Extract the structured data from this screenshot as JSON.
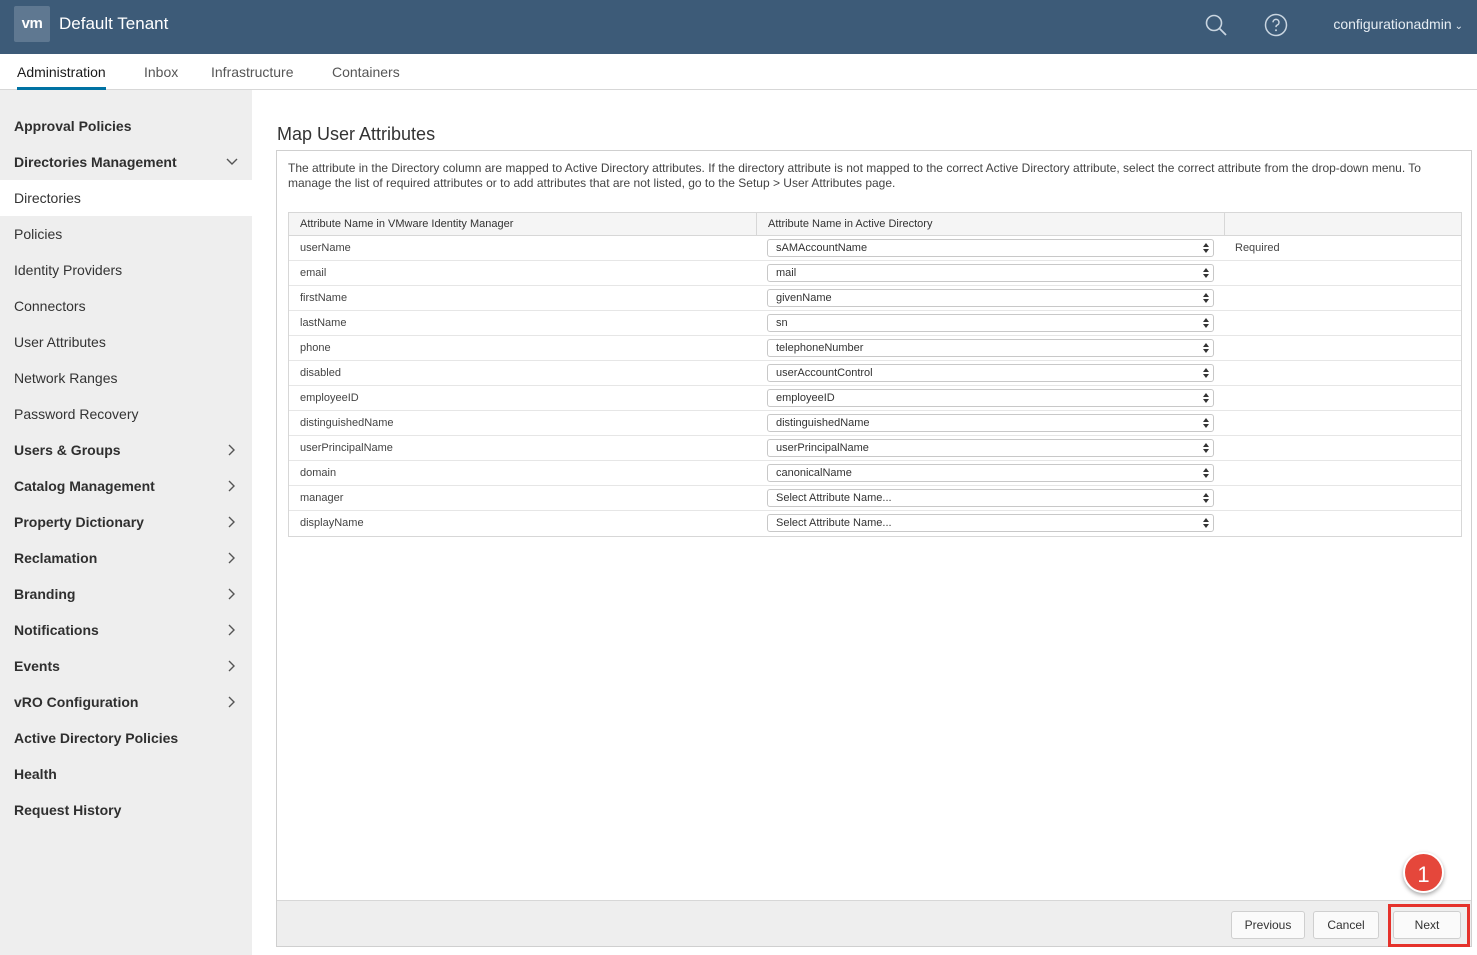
{
  "header": {
    "logo": "vm",
    "tenant": "Default Tenant",
    "user": "configurationadmin"
  },
  "tabs": [
    {
      "label": "Administration",
      "active": true
    },
    {
      "label": "Inbox"
    },
    {
      "label": "Infrastructure"
    },
    {
      "label": "Containers"
    }
  ],
  "sidebar": {
    "items": [
      {
        "label": "Approval Policies"
      },
      {
        "label": "Directories Management"
      },
      {
        "label": "Directories"
      },
      {
        "label": "Policies"
      },
      {
        "label": "Identity Providers"
      },
      {
        "label": "Connectors"
      },
      {
        "label": "User Attributes"
      },
      {
        "label": "Network Ranges"
      },
      {
        "label": "Password Recovery"
      },
      {
        "label": "Users & Groups"
      },
      {
        "label": "Catalog Management"
      },
      {
        "label": "Property Dictionary"
      },
      {
        "label": "Reclamation"
      },
      {
        "label": "Branding"
      },
      {
        "label": "Notifications"
      },
      {
        "label": "Events"
      },
      {
        "label": "vRO Configuration"
      },
      {
        "label": "Active Directory Policies"
      },
      {
        "label": "Health"
      },
      {
        "label": "Request History"
      }
    ]
  },
  "main": {
    "title": "Map User Attributes",
    "description": "The attribute in the Directory column are mapped to Active Directory attributes. If the directory attribute is not mapped to the correct Active Directory attribute, select the correct attribute from the drop-down menu. To manage the list of required attributes or to add attributes that are not listed, go to the Setup > User Attributes page.",
    "columns": [
      "Attribute Name in VMware Identity Manager",
      "Attribute Name in Active Directory",
      ""
    ],
    "rows": [
      {
        "name": "userName",
        "value": "sAMAccountName",
        "note": "Required"
      },
      {
        "name": "email",
        "value": "mail",
        "note": ""
      },
      {
        "name": "firstName",
        "value": "givenName",
        "note": ""
      },
      {
        "name": "lastName",
        "value": "sn",
        "note": ""
      },
      {
        "name": "phone",
        "value": "telephoneNumber",
        "note": ""
      },
      {
        "name": "disabled",
        "value": "userAccountControl",
        "note": ""
      },
      {
        "name": "employeeID",
        "value": "employeeID",
        "note": ""
      },
      {
        "name": "distinguishedName",
        "value": "distinguishedName",
        "note": ""
      },
      {
        "name": "userPrincipalName",
        "value": "userPrincipalName",
        "note": ""
      },
      {
        "name": "domain",
        "value": "canonicalName",
        "note": ""
      },
      {
        "name": "manager",
        "value": "Select Attribute Name...",
        "note": ""
      },
      {
        "name": "displayName",
        "value": "Select Attribute Name...",
        "note": ""
      }
    ],
    "buttons": {
      "previous": "Previous",
      "cancel": "Cancel",
      "next": "Next"
    }
  },
  "callout": {
    "number": "1",
    "color": "#e5473b"
  },
  "colors": {
    "header_bg": "#3d5b78",
    "accent": "#0072a3",
    "sidebar_bg": "#eeeeee"
  }
}
